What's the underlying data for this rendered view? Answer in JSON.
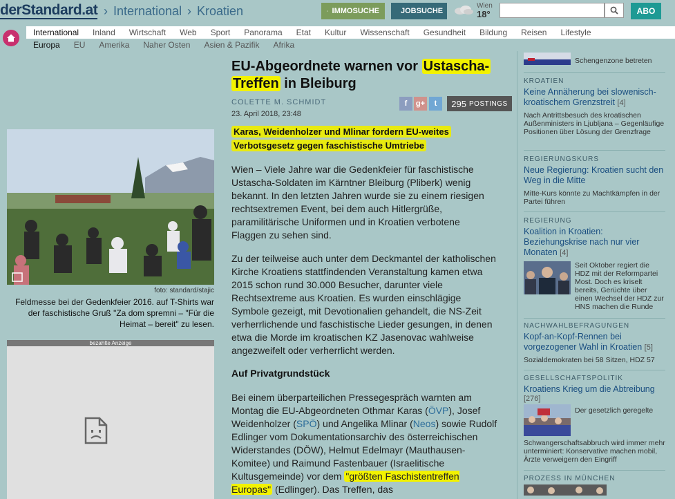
{
  "header": {
    "logo": "derStandard.at",
    "breadcrumb": [
      "›",
      "International",
      "›",
      "Kroatien"
    ],
    "immo_label": "IMMOSUCHE",
    "jobs_label": "JOBSUCHE",
    "weather_city": "Wien",
    "weather_temp": "18°",
    "search_placeholder": "",
    "abo_label": "ABO"
  },
  "nav_primary": [
    "International",
    "Inland",
    "Wirtschaft",
    "Web",
    "Sport",
    "Panorama",
    "Etat",
    "Kultur",
    "Wissenschaft",
    "Gesundheit",
    "Bildung",
    "Reisen",
    "Lifestyle"
  ],
  "nav_secondary": [
    "Europa",
    "EU",
    "Amerika",
    "Naher Osten",
    "Asien & Pazifik",
    "Afrika"
  ],
  "article": {
    "headline_a": "EU-Abgeordnete warnen vor ",
    "headline_hl1": "Ustascha-",
    "headline_hl2": "Treffen",
    "headline_b": " in Bleiburg",
    "author": "COLETTE M. SCHMIDT",
    "date": "23. April 2018, 23:48",
    "share_fb": "f",
    "share_gp": "g+",
    "share_tw": "t",
    "postings_count": "295",
    "postings_label": "POSTINGS",
    "lead": "Karas, Weidenholzer und Mlinar fordern EU-weites Verbotsgesetz gegen faschistische Umtriebe",
    "p1": "Wien – Viele Jahre war die Gedenkfeier für faschistische Ustascha-Soldaten im Kärntner Bleiburg (Pliberk) wenig bekannt. In den letzten Jahren wurde sie zu einem riesigen rechtsextremen Event, bei dem auch Hitlergrüße, paramilitärische Uniformen und in Kroatien verbotene Flaggen zu sehen sind.",
    "p2": "Zu der teilweise auch unter dem Deckmantel der katholischen Kirche Kroatiens stattfindenden Veranstaltung kamen etwa 2015 schon rund 30.000 Besucher, darunter viele Rechtsextreme aus Kroatien. Es wurden einschlägige Symbole gezeigt, mit Devotionalien gehandelt, die NS-Zeit verherrlichende und faschistische Lieder gesungen, in denen etwa die Morde im kroatischen KZ Jasenovac wahlweise angezweifelt oder verherrlicht werden.",
    "subhead": "Auf Privatgrundstück",
    "p3_a": "Bei einem überparteilichen Pressegespräch warnten am Montag die EU-Abgeordneten Othmar Karas (",
    "p3_l1": "ÖVP",
    "p3_b": "), Josef Weidenholzer (",
    "p3_l2": "SPÖ",
    "p3_c": ") und Angelika Mlinar (",
    "p3_l3": "Neos",
    "p3_d": ") sowie Rudolf Edlinger vom Dokumentationsarchiv des österreichischen Widerstandes (DÖW), Helmut Edelmayr (Mauthausen-Komitee) und Raimund Fastenbauer (Israelitische Kultusgemeinde) vor dem ",
    "p3_hl": "\"größten Faschistentreffen Europas\"",
    "p3_e": " (Edlinger). Das Treffen, das"
  },
  "photo": {
    "credit": "foto: standard/stajic",
    "caption": "Feldmesse bei der Gedenkfeier 2016. auf T-Shirts war der faschistische Gruß \"Za dom spremni – \"Für die Heimat – bereit\" zu lesen."
  },
  "ad": {
    "label": "bezahlte Anzeige"
  },
  "sidebar": {
    "top_partial": "Schengenzone betreten",
    "items": [
      {
        "label": "KROATIEN",
        "title": "Keine Annäherung bei slowenisch-kroatischem Grenzstreit",
        "count": "[4]",
        "text": "Nach Antrittsbesuch des kroatischen Außenministers in Ljubljana – Gegenläufige Positionen über Lösung der Grenzfrage"
      },
      {
        "label": "REGIERUNGSKURS",
        "title": "Neue Regierung: Kroatien sucht den Weg in die Mitte",
        "count": "",
        "text": "Mitte-Kurs könnte zu Machtkämpfen in der Partei führen"
      },
      {
        "label": "REGIERUNG",
        "title": "Koalition in Kroatien: Beziehungskrise nach nur vier Monaten",
        "count": "[4]",
        "text": "Seit Oktober regiert die HDZ mit der Reformpartei Most. Doch es kriselt bereits, Gerüchte über einen Wechsel der HDZ zur HNS machen die Runde"
      },
      {
        "label": "NACHWAHLBEFRAGUNGEN",
        "title": "Kopf-an-Kopf-Rennen bei vorgezogener Wahl in Kroatien",
        "count": "[5]",
        "text": "Sozialdemokraten bei 58 Sitzen, HDZ 57"
      },
      {
        "label": "GESELLSCHAFTSPOLITIK",
        "title": "Kroatiens Krieg um die Abtreibung",
        "count": "[276]",
        "text": "Der gesetzlich geregelte Schwangerschaftsabbruch wird immer mehr unterminiert: Konservative machen mobil, Ärzte verweigern den Eingriff"
      },
      {
        "label": "PROZESS IN MÜNCHEN",
        "title": "",
        "count": "",
        "text": ""
      }
    ]
  },
  "colors": {
    "accent": "#1a4e80",
    "highlight": "#f2f200",
    "background": "#a9c7c7"
  }
}
